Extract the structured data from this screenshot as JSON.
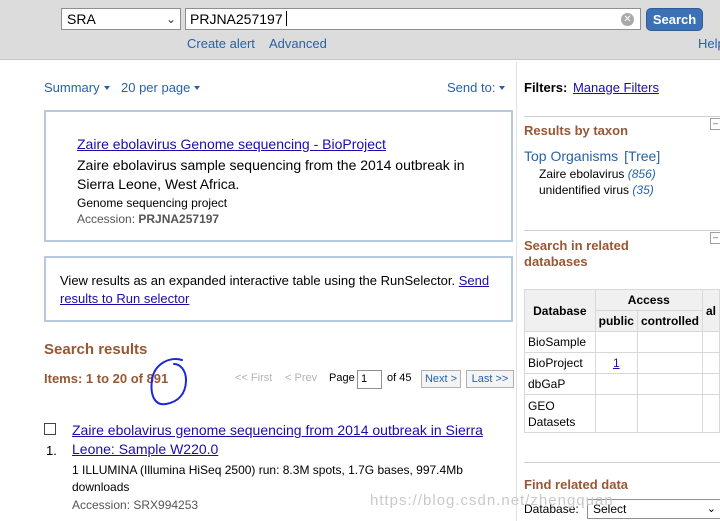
{
  "header": {
    "db_selected": "SRA",
    "search_term": "PRJNA257197",
    "search_button": "Search",
    "create_alert": "Create alert",
    "advanced": "Advanced",
    "help": "Help"
  },
  "display": {
    "summary": "Summary",
    "per_page": "20 per page",
    "send_to": "Send to:"
  },
  "sensor": {
    "title": "Zaire ebolavirus Genome sequencing - BioProject",
    "description": "Zaire ebolavirus sample sequencing from the 2014 outbreak in Sierra Leone, West Africa.",
    "subtype": "Genome sequencing project",
    "accession_label": "Accession:",
    "accession": "PRJNA257197"
  },
  "runselector": {
    "text": "View results as an expanded interactive table using the RunSelector.",
    "link": "Send results to Run selector"
  },
  "results": {
    "heading": "Search results",
    "items": "Items: 1 to 20 of 891",
    "first": "<< First",
    "prev": "< Prev",
    "page_label": "Page",
    "page_value": "1",
    "of_pages": "of 45",
    "next": "Next >",
    "last": "Last >>",
    "list": [
      {
        "num": "1.",
        "title": "Zaire ebolavirus genome sequencing from 2014 outbreak in Sierra Leone: Sample W220.0",
        "desc": "1 ILLUMINA (Illumina HiSeq 2500) run: 8.3M spots, 1.7G bases, 997.4Mb downloads",
        "accession": "Accession: SRX994253"
      }
    ]
  },
  "sidebar": {
    "filters_label": "Filters:",
    "manage_filters": "Manage Filters",
    "taxon": {
      "heading": "Results by taxon",
      "top_organisms": "Top Organisms",
      "tree": "[Tree]",
      "items": [
        {
          "name": "Zaire ebolavirus",
          "count": "(856)"
        },
        {
          "name": "unidentified virus",
          "count": "(35)"
        }
      ]
    },
    "related": {
      "heading": "Search in related databases",
      "col_database": "Database",
      "col_access": "Access",
      "col_public": "public",
      "col_controlled": "controlled",
      "col_extra": "al",
      "rows": [
        {
          "db": "BioSample",
          "public": ""
        },
        {
          "db": "BioProject",
          "public": "1"
        },
        {
          "db": "dbGaP",
          "public": ""
        },
        {
          "db": "GEO Datasets",
          "public": ""
        }
      ]
    },
    "find_related": {
      "heading": "Find related data",
      "db_label": "Database:",
      "select_value": "Select"
    }
  },
  "watermark": "https://blog.csdn.net/zhengquan"
}
